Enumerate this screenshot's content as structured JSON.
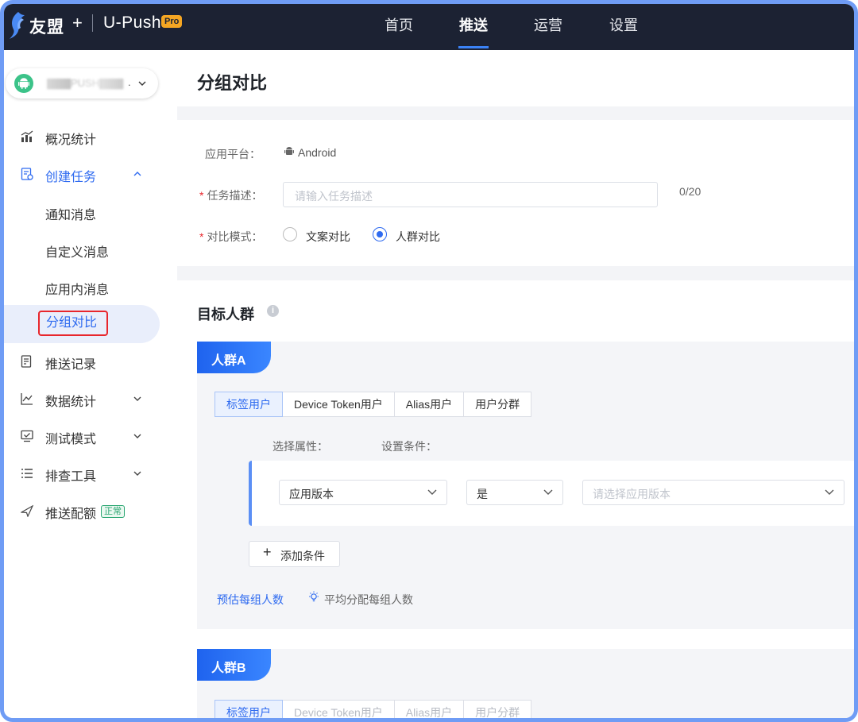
{
  "header": {
    "brand": "友盟",
    "brand_plus": "+",
    "product": "U-Push",
    "badge": "Pro",
    "nav": [
      "首页",
      "推送",
      "运营",
      "设置"
    ],
    "active_nav": "推送"
  },
  "sidebar": {
    "app_name": "▇▇▇PUSH▇▇▇",
    "app_name_suffix": ".",
    "items": [
      {
        "label": "概况统计",
        "icon": "chart-bar-icon"
      },
      {
        "label": "创建任务",
        "icon": "task-icon"
      },
      {
        "label": "推送记录",
        "icon": "record-icon"
      },
      {
        "label": "数据统计",
        "icon": "line-chart-icon"
      },
      {
        "label": "测试模式",
        "icon": "monitor-icon"
      },
      {
        "label": "排查工具",
        "icon": "list-icon"
      },
      {
        "label": "推送配额",
        "icon": "send-icon"
      }
    ],
    "sub_items": [
      "通知消息",
      "自定义消息",
      "应用内消息",
      "分组对比"
    ],
    "active_sub": "分组对比",
    "quota_status": "正常"
  },
  "page": {
    "title": "分组对比"
  },
  "form": {
    "platform_label": "应用平台：",
    "platform_value": "Android",
    "desc_label": "任务描述：",
    "desc_placeholder": "请输入任务描述",
    "desc_counter": "0/20",
    "mode_label": "对比模式：",
    "mode_options": [
      "文案对比",
      "人群对比"
    ],
    "mode_selected": "人群对比",
    "required_mark": "*"
  },
  "target": {
    "title": "目标人群",
    "info": "i",
    "group_a": {
      "name": "人群A",
      "tabs": [
        "标签用户",
        "Device Token用户",
        "Alias用户",
        "用户分群"
      ],
      "active_tab": "标签用户",
      "attr_header": "选择属性：",
      "cond_header": "设置条件：",
      "attr_value": "应用版本",
      "op_value": "是",
      "value_placeholder": "请选择应用版本",
      "add_condition": "添加条件",
      "estimate_link": "预估每组人数",
      "average_hint": "平均分配每组人数"
    },
    "group_b": {
      "name": "人群B",
      "tabs": [
        "标签用户",
        "Device Token用户",
        "Alias用户",
        "用户分群"
      ],
      "active_tab": "标签用户"
    }
  },
  "colors": {
    "header_bg": "#1c2233",
    "accent": "#2f6bf0",
    "highlight_border": "#e8262c",
    "android_green": "#3cc389"
  }
}
